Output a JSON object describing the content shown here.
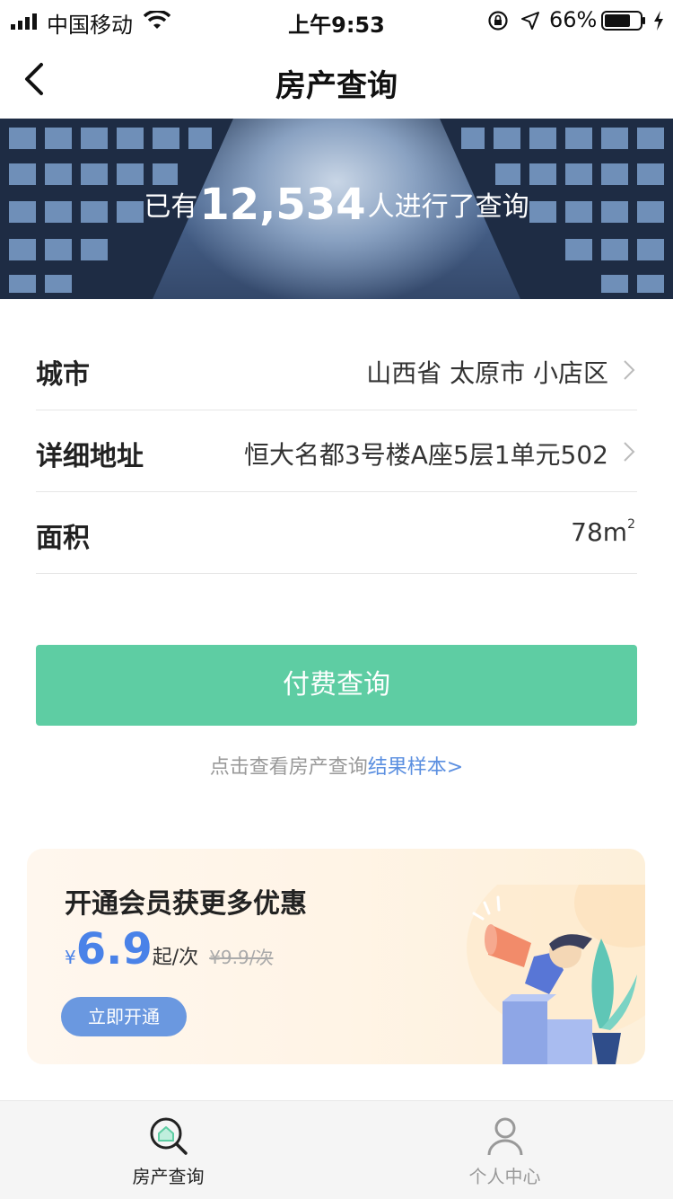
{
  "status_bar": {
    "carrier": "中国移动",
    "time": "上午9:53",
    "battery": "66%"
  },
  "nav": {
    "title": "房产查询"
  },
  "banner": {
    "prefix": "已有",
    "count": "12,534",
    "suffix": "人进行了查询"
  },
  "form": {
    "city": {
      "label": "城市",
      "value": "山西省 太原市 小店区"
    },
    "address": {
      "label": "详细地址",
      "value": "恒大名都3号楼A座5层1单元502"
    },
    "area": {
      "label": "面积",
      "value": "78m",
      "unit_sup": "2"
    }
  },
  "pay_button": {
    "label": "付费查询"
  },
  "sample": {
    "text": "点击查看房产查询",
    "link": "结果样本>"
  },
  "member": {
    "title": "开通会员获更多优惠",
    "currency": "¥",
    "price": "6.9",
    "unit": "起/次",
    "old_price": "¥9.9/次",
    "button": "立即开通"
  },
  "tabs": [
    {
      "label": "房产查询",
      "icon": "house-search-icon",
      "active": true
    },
    {
      "label": "个人中心",
      "icon": "person-icon",
      "active": false
    }
  ],
  "colors": {
    "accent_green": "#5ecda3",
    "link_blue": "#5b8fe0",
    "price_blue": "#4a82e8",
    "tab_active": "#222222",
    "tab_inactive": "#999999"
  }
}
